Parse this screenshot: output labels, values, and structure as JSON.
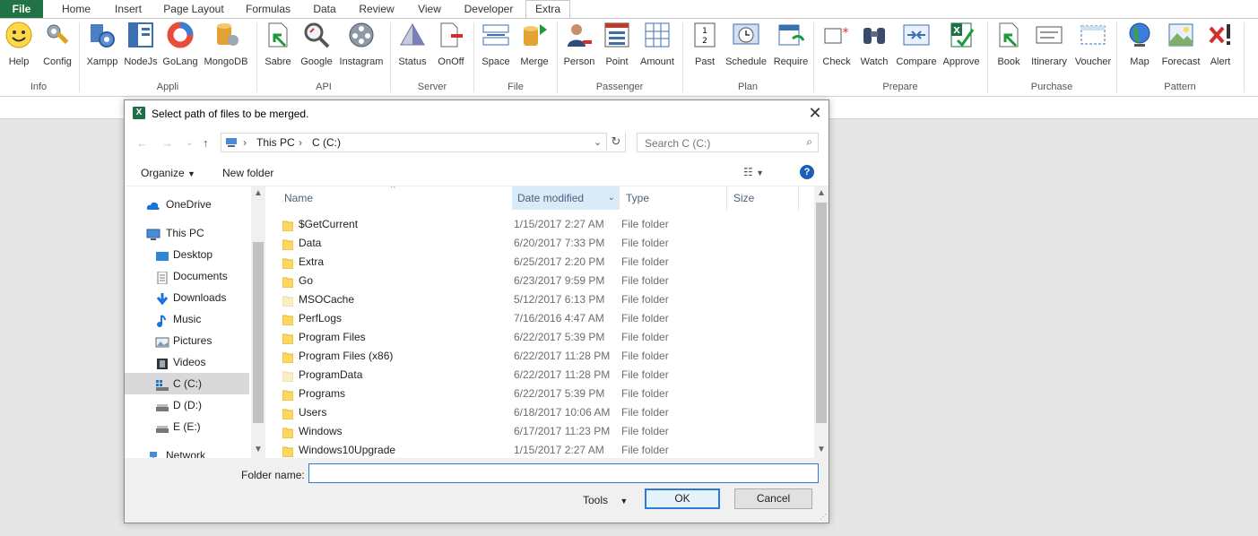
{
  "ribbon": {
    "tabs": [
      "File",
      "Home",
      "Insert",
      "Page Layout",
      "Formulas",
      "Data",
      "Review",
      "View",
      "Developer",
      "Extra"
    ],
    "active_tab": "Extra",
    "groups": [
      {
        "label": "Info",
        "buttons": [
          "Help",
          "Config"
        ]
      },
      {
        "label": "Appli",
        "buttons": [
          "Xampp",
          "NodeJs",
          "GoLang",
          "MongoDB"
        ]
      },
      {
        "label": "API",
        "buttons": [
          "Sabre",
          "Google",
          "Instagram"
        ]
      },
      {
        "label": "Server",
        "buttons": [
          "Status",
          "OnOff"
        ]
      },
      {
        "label": "File",
        "buttons": [
          "Space",
          "Merge"
        ]
      },
      {
        "label": "Passenger",
        "buttons": [
          "Person",
          "Point",
          "Amount"
        ]
      },
      {
        "label": "Plan",
        "buttons": [
          "Past",
          "Schedule",
          "Require"
        ]
      },
      {
        "label": "Prepare",
        "buttons": [
          "Check",
          "Watch",
          "Compare",
          "Approve"
        ]
      },
      {
        "label": "Purchase",
        "buttons": [
          "Book",
          "Itinerary",
          "Voucher"
        ]
      },
      {
        "label": "Pattern",
        "buttons": [
          "Map",
          "Forecast",
          "Alert"
        ]
      }
    ]
  },
  "dialog": {
    "title": "Select path of files to be merged.",
    "address": [
      "This PC",
      "C (C:)"
    ],
    "search_placeholder": "Search C (C:)",
    "organize_label": "Organize",
    "new_folder_label": "New folder",
    "nav": [
      {
        "label": "OneDrive",
        "icon": "cloud-icon"
      },
      {
        "label": "This PC",
        "icon": "computer-icon"
      },
      {
        "label": "Desktop",
        "icon": "desktop-icon"
      },
      {
        "label": "Documents",
        "icon": "documents-icon"
      },
      {
        "label": "Downloads",
        "icon": "download-icon"
      },
      {
        "label": "Music",
        "icon": "music-icon"
      },
      {
        "label": "Pictures",
        "icon": "pictures-icon"
      },
      {
        "label": "Videos",
        "icon": "videos-icon"
      },
      {
        "label": "C (C:)",
        "icon": "drive-icon"
      },
      {
        "label": "D (D:)",
        "icon": "drive-icon"
      },
      {
        "label": "E (E:)",
        "icon": "drive-icon"
      },
      {
        "label": "Network",
        "icon": "network-icon"
      }
    ],
    "selected_nav": "C (C:)",
    "columns": {
      "name": "Name",
      "date": "Date modified",
      "type": "Type",
      "size": "Size"
    },
    "files": [
      {
        "name": "$GetCurrent",
        "date": "1/15/2017 2:27 AM",
        "type": "File folder",
        "faded": false
      },
      {
        "name": "Data",
        "date": "6/20/2017 7:33 PM",
        "type": "File folder",
        "faded": false
      },
      {
        "name": "Extra",
        "date": "6/25/2017 2:20 PM",
        "type": "File folder",
        "faded": false
      },
      {
        "name": "Go",
        "date": "6/23/2017 9:59 PM",
        "type": "File folder",
        "faded": false
      },
      {
        "name": "MSOCache",
        "date": "5/12/2017 6:13 PM",
        "type": "File folder",
        "faded": true
      },
      {
        "name": "PerfLogs",
        "date": "7/16/2016 4:47 AM",
        "type": "File folder",
        "faded": false
      },
      {
        "name": "Program Files",
        "date": "6/22/2017 5:39 PM",
        "type": "File folder",
        "faded": false
      },
      {
        "name": "Program Files (x86)",
        "date": "6/22/2017 11:28 PM",
        "type": "File folder",
        "faded": false
      },
      {
        "name": "ProgramData",
        "date": "6/22/2017 11:28 PM",
        "type": "File folder",
        "faded": true
      },
      {
        "name": "Programs",
        "date": "6/22/2017 5:39 PM",
        "type": "File folder",
        "faded": false
      },
      {
        "name": "Users",
        "date": "6/18/2017 10:06 AM",
        "type": "File folder",
        "faded": false
      },
      {
        "name": "Windows",
        "date": "6/17/2017 11:23 PM",
        "type": "File folder",
        "faded": false
      },
      {
        "name": "Windows10Upgrade",
        "date": "1/15/2017 2:27 AM",
        "type": "File folder",
        "faded": false
      }
    ],
    "folder_name_label": "Folder name:",
    "folder_name_value": "",
    "tools_label": "Tools",
    "ok_label": "OK",
    "cancel_label": "Cancel"
  },
  "colors": {
    "excel_green": "#217346",
    "accent": "#2c7cd3",
    "selection": "#d9d9d9",
    "folder": "#ffd75e"
  }
}
